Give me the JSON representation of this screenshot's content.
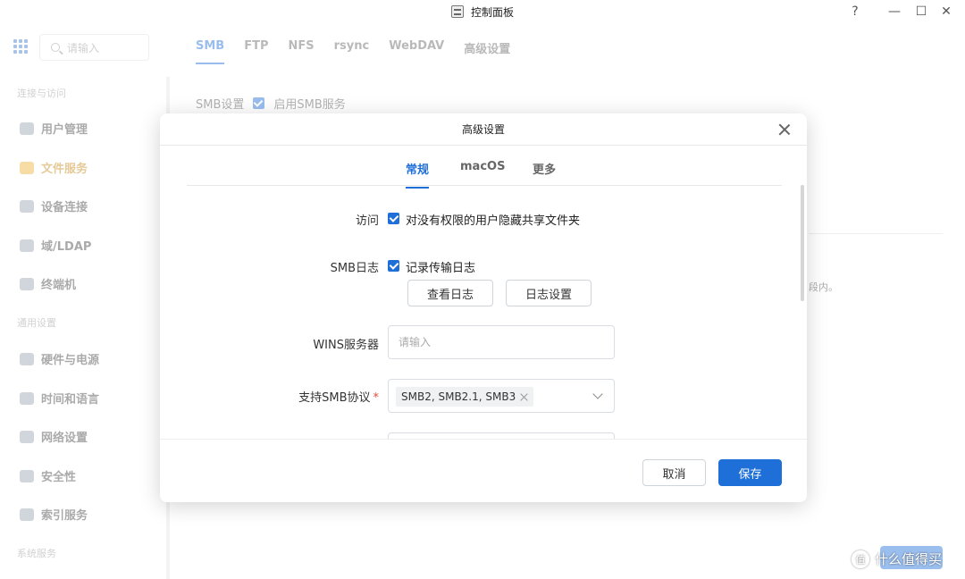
{
  "window": {
    "title": "控制面板",
    "help_glyph": "?",
    "minimize_glyph": "—",
    "maximize_glyph": "☐",
    "close_glyph": "✕"
  },
  "background": {
    "search_placeholder": "请输入",
    "top_tabs": [
      "SMB",
      "FTP",
      "NFS",
      "rsync",
      "WebDAV",
      "高级设置"
    ],
    "sidebar": {
      "groups": [
        "连接与访问",
        "通用设置",
        "系统服务"
      ],
      "items": [
        "用户管理",
        "文件服务",
        "设备连接",
        "域/LDAP",
        "终端机",
        "硬件与电源",
        "时间和语言",
        "网络设置",
        "安全性",
        "索引服务"
      ]
    },
    "smb_settings_label": "SMB设置",
    "smb_enable_label": "启用SMB服务",
    "text_fragment": "段内。"
  },
  "modal": {
    "title": "高级设置",
    "tabs": [
      "常规",
      "macOS",
      "更多"
    ],
    "access_label": "访问",
    "access_option": "对没有权限的用户隐藏共享文件夹",
    "smb_log_label": "SMB日志",
    "smb_log_option": "记录传输日志",
    "view_log_button": "查看日志",
    "log_settings_button": "日志设置",
    "wins_label": "WINS服务器",
    "wins_placeholder": "请输入",
    "protocol_label": "支持SMB协议",
    "protocol_required": "*",
    "protocol_value": "SMB2, SMB2.1, SMB3",
    "cancel_button": "取消",
    "save_button": "保存"
  },
  "watermark": {
    "icon_text": "值",
    "text": "什么值得买"
  },
  "colors": {
    "accent": "#1f6fd9",
    "required": "#e34d3b",
    "sidebar_active": "#f0b23c"
  }
}
